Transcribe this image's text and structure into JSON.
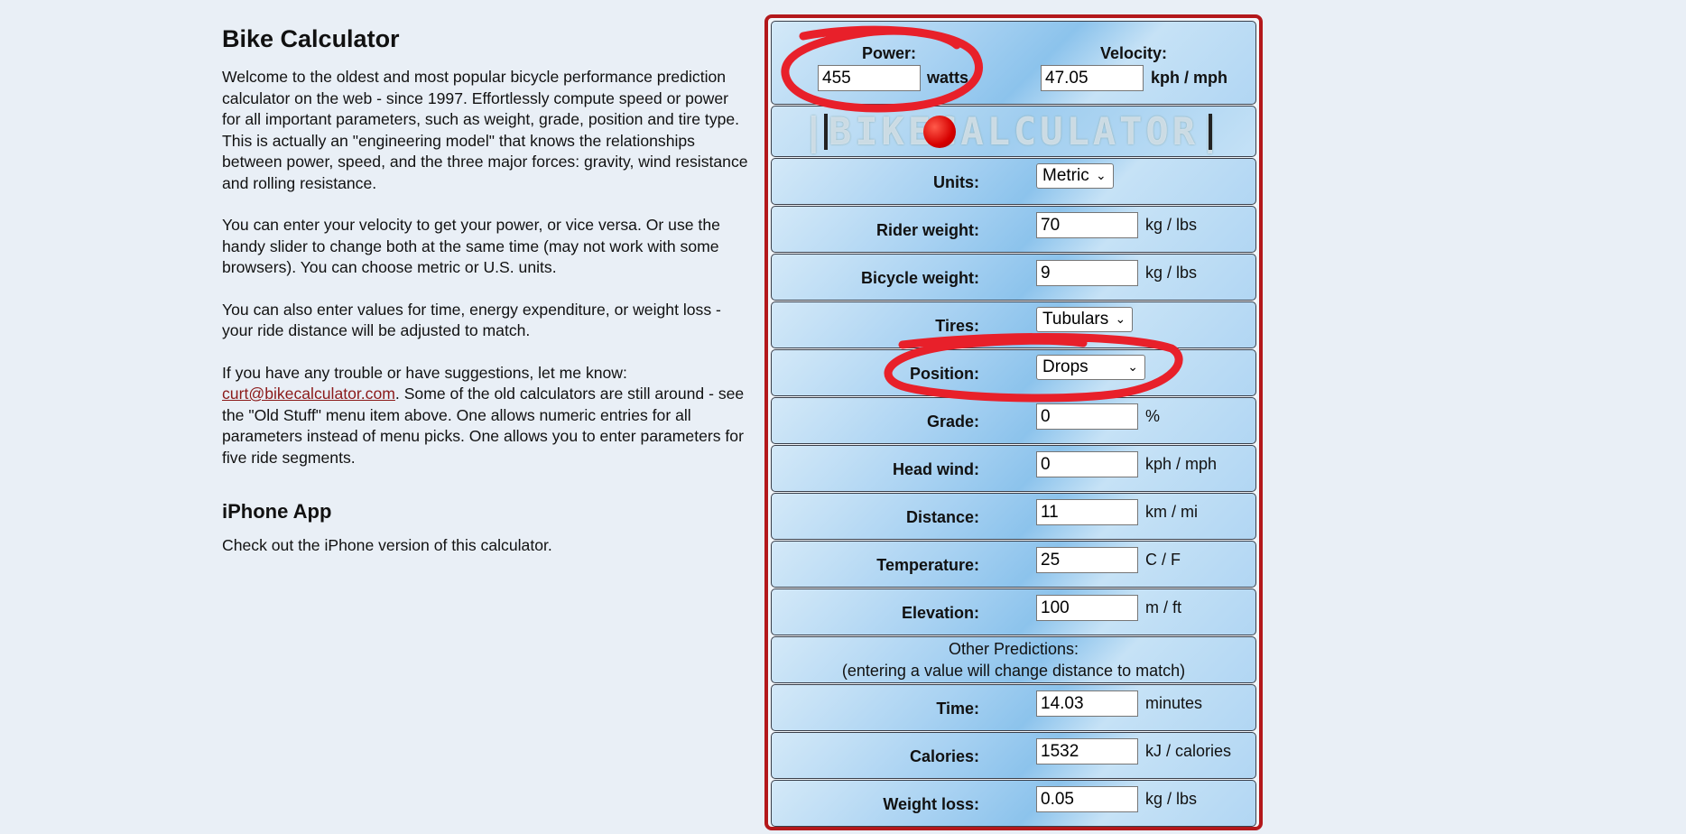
{
  "intro": {
    "title": "Bike Calculator",
    "p1": "Welcome to the oldest and most popular bicycle performance prediction calculator on the web - since 1997. Effortlessly compute speed or power for all important parameters, such as weight, grade, position and tire type. This is actually an \"engineering model\" that knows the relationships between power, speed, and the three major forces: gravity, wind resistance and rolling resistance.",
    "p2": "You can enter your velocity to get your power, or vice versa. Or use the handy slider to change both at the same time (may not work with some browsers). You can choose metric or U.S. units.",
    "p3": "You can also enter values for time, energy expenditure, or weight loss - your ride distance will be adjusted to match.",
    "p4_pre": "If you have any trouble or have suggestions, let me know: ",
    "p4_link": "curt@bikecalculator.com",
    "p4_post": ". Some of the old calculators are still around - see the \"Old Stuff\" menu item above. One allows numeric entries for all parameters instead of menu picks. One allows you to enter parameters for five ride segments.",
    "iphone_title": "iPhone App",
    "iphone_text": "Check out the iPhone version of this calculator."
  },
  "calc": {
    "power_label": "Power:",
    "power_value": "455",
    "power_unit": "watts",
    "velocity_label": "Velocity:",
    "velocity_value": "47.05",
    "velocity_unit": "kph / mph",
    "logo_text": "|BIKECALCULATOR|",
    "units_label": "Units:",
    "units_value": "Metric",
    "rider_label": "Rider weight:",
    "rider_value": "70",
    "rider_unit": "kg / lbs",
    "bike_label": "Bicycle weight:",
    "bike_value": "9",
    "bike_unit": "kg / lbs",
    "tires_label": "Tires:",
    "tires_value": "Tubulars",
    "position_label": "Position:",
    "position_value": "Drops",
    "grade_label": "Grade:",
    "grade_value": "0",
    "grade_unit": "%",
    "wind_label": "Head wind:",
    "wind_value": "0",
    "wind_unit": "kph / mph",
    "distance_label": "Distance:",
    "distance_value": "11",
    "distance_unit": "km / mi",
    "temp_label": "Temperature:",
    "temp_value": "25",
    "temp_unit": "C / F",
    "elev_label": "Elevation:",
    "elev_value": "100",
    "elev_unit": "m / ft",
    "other_line1": "Other Predictions:",
    "other_line2": "(entering a value will change distance to match)",
    "time_label": "Time:",
    "time_value": "14.03",
    "time_unit": "minutes",
    "cal_label": "Calories:",
    "cal_value": "1532",
    "cal_unit": "kJ / calories",
    "wl_label": "Weight loss:",
    "wl_value": "0.05",
    "wl_unit": "kg / lbs"
  },
  "colors": {
    "annotation": "#e8202a",
    "panel_border": "#b3181b",
    "link": "#8b1a1a"
  }
}
